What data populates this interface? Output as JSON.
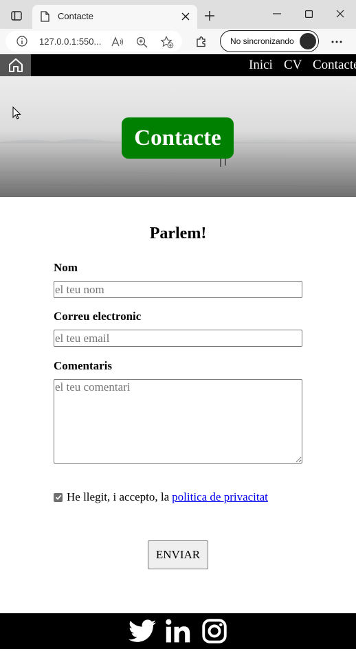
{
  "browser": {
    "tab_title": "Contacte",
    "url": "127.0.0.1:550...",
    "sync_label": "No sincronizando"
  },
  "site_nav": {
    "links": [
      {
        "label": "Inici"
      },
      {
        "label": "CV"
      },
      {
        "label": "Contacte"
      }
    ]
  },
  "hero": {
    "title": "Contacte"
  },
  "form": {
    "heading": "Parlem!",
    "name_label": "Nom",
    "name_placeholder": "el teu nom",
    "email_label": "Correu electronic",
    "email_placeholder": "el teu email",
    "comments_label": "Comentaris",
    "comments_placeholder": "el teu comentari",
    "consent_text": "He llegit, i accepto, la",
    "consent_checked": true,
    "privacy_link": "politica de privacitat",
    "submit_label": "ENVIAR"
  },
  "footer": {
    "social": [
      "twitter-icon",
      "linkedin-icon",
      "instagram-icon"
    ]
  },
  "colors": {
    "hero_badge": "#008000",
    "nav_background": "#000000",
    "home_background": "#555555",
    "link": "#0000ee"
  }
}
